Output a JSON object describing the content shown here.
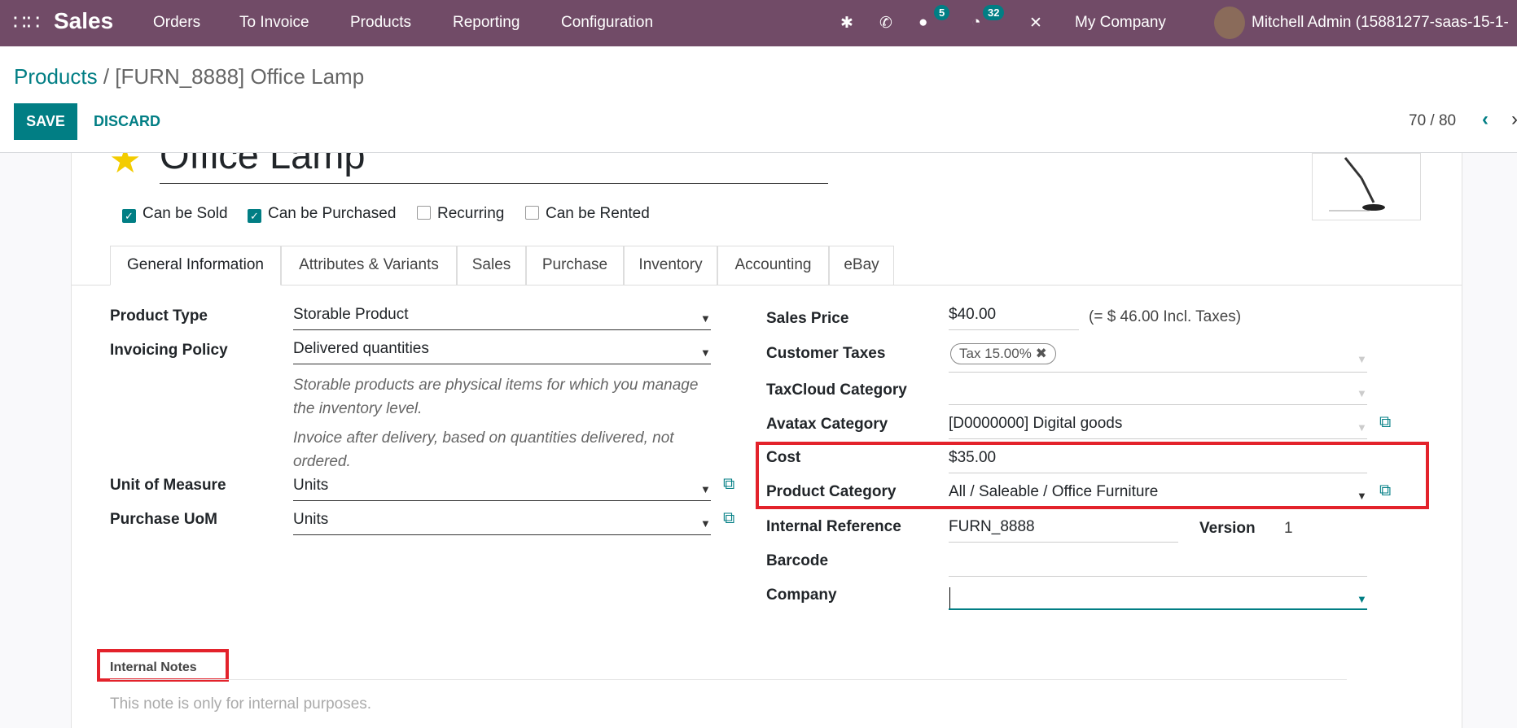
{
  "navbar": {
    "app": "Sales",
    "menu": [
      "Orders",
      "To Invoice",
      "Products",
      "Reporting",
      "Configuration"
    ],
    "messages_count": "5",
    "activities_count": "32",
    "company": "My Company",
    "user": "Mitchell Admin (15881277-saas-15-1-",
    "color": "#714B67"
  },
  "breadcrumb": {
    "parent": "Products",
    "current": "/ [FURN_8888] Office Lamp"
  },
  "toolbar": {
    "save": "SAVE",
    "discard": "DISCARD",
    "pager": "70 / 80"
  },
  "product": {
    "name": "Office Lamp",
    "favorite": true,
    "flags": [
      {
        "label": "Can be Sold",
        "checked": true
      },
      {
        "label": "Can be Purchased",
        "checked": true
      },
      {
        "label": "Recurring",
        "checked": false
      },
      {
        "label": "Can be Rented",
        "checked": false
      }
    ]
  },
  "tabs": [
    "General Information",
    "Attributes & Variants",
    "Sales",
    "Purchase",
    "Inventory",
    "Accounting",
    "eBay"
  ],
  "left": {
    "product_type_label": "Product Type",
    "product_type": "Storable Product",
    "invoicing_policy_label": "Invoicing Policy",
    "invoicing_policy": "Delivered quantities",
    "help1": "Storable products are physical items for which you manage the inventory level.",
    "help2": "Invoice after delivery, based on quantities delivered, not ordered.",
    "uom_label": "Unit of Measure",
    "uom": "Units",
    "purchase_uom_label": "Purchase UoM",
    "purchase_uom": "Units"
  },
  "right": {
    "sales_price_label": "Sales Price",
    "sales_price": "$40.00",
    "incl_taxes": "(= $ 46.00 Incl. Taxes)",
    "customer_taxes_label": "Customer Taxes",
    "tax_tag": "Tax 15.00%",
    "taxcloud_label": "TaxCloud Category",
    "avatax_label": "Avatax Category",
    "avatax": "[D0000000] Digital goods",
    "cost_label": "Cost",
    "cost": "$35.00",
    "category_label": "Product Category",
    "category": "All / Saleable / Office Furniture",
    "ref_label": "Internal Reference",
    "ref": "FURN_8888",
    "version_label": "Version",
    "version": "1",
    "barcode_label": "Barcode",
    "company_label": "Company"
  },
  "notes": {
    "label": "Internal Notes",
    "placeholder": "This note is only for internal purposes."
  },
  "highlight_color": "#e3222b",
  "accent": "#017e84"
}
